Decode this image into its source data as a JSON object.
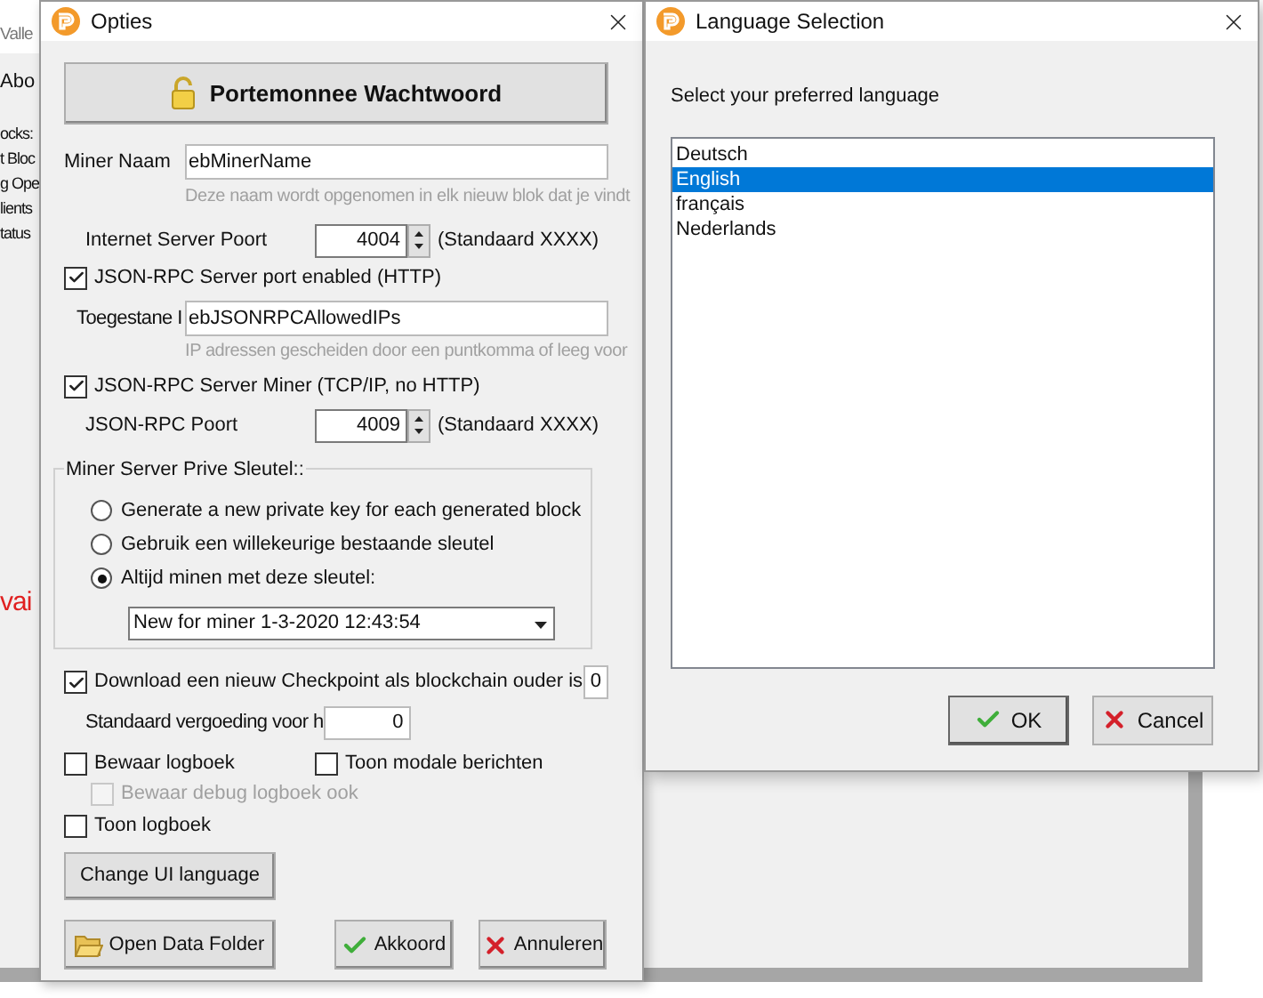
{
  "background_window": {
    "title": "Valle",
    "menu": "Abo",
    "lines": [
      "ocks:",
      "t Bloc",
      "g Ope",
      "lients",
      "tatus"
    ],
    "alert": "vai"
  },
  "options_dialog": {
    "title": "Opties",
    "password_button": "Portemonnee Wachtwoord",
    "miner_name": {
      "label": "Miner Naam",
      "value": "ebMinerName",
      "hint": "Deze naam wordt opgenomen in elk nieuw blok dat je vindt"
    },
    "server_port": {
      "label": "Internet Server Poort",
      "value": "4004",
      "note": "(Standaard XXXX)"
    },
    "rpc_enabled": {
      "label": "JSON-RPC Server port enabled (HTTP)",
      "checked": true
    },
    "allowed_ips": {
      "label": "Toegestane I",
      "value": "ebJSONRPCAllowedIPs",
      "hint": "IP adressen gescheiden door een puntkomma of leeg voor"
    },
    "rpc_miner": {
      "label": "JSON-RPC Server Miner (TCP/IP, no HTTP)",
      "checked": true
    },
    "rpc_port": {
      "label": "JSON-RPC Poort",
      "value": "4009",
      "note": "(Standaard XXXX)"
    },
    "key_group": {
      "title": "Miner Server Prive Sleutel::",
      "options": [
        {
          "label": "Generate a new private key for each generated block",
          "selected": false
        },
        {
          "label": "Gebruik een willekeurige bestaande sleutel",
          "selected": false
        },
        {
          "label": "Altijd minen met deze sleutel:",
          "selected": true
        }
      ],
      "key_select": "New for miner 1-3-2020 12:43:54"
    },
    "checkpoint": {
      "label": "Download een nieuw Checkpoint als blockchain ouder is",
      "checked": true,
      "value": "0"
    },
    "default_fee": {
      "label": "Standaard vergoeding voor h",
      "value": "0"
    },
    "save_log": {
      "label": "Bewaar logboek",
      "checked": false
    },
    "modal_messages": {
      "label": "Toon modale berichten",
      "checked": false
    },
    "save_debug_log": {
      "label": "Bewaar debug logboek ook",
      "checked": false,
      "disabled": true
    },
    "show_log": {
      "label": "Toon logboek",
      "checked": false
    },
    "change_language_button": "Change UI language",
    "buttons": [
      {
        "kind": "folder",
        "label": "Open Data Folder"
      },
      {
        "kind": "ok",
        "label": "Akkoord"
      },
      {
        "kind": "cancel",
        "label": "Annuleren"
      }
    ]
  },
  "language_dialog": {
    "title": "Language Selection",
    "prompt": "Select your preferred language",
    "languages": [
      {
        "label": "Deutsch",
        "selected": false
      },
      {
        "label": "English",
        "selected": true
      },
      {
        "label": "français",
        "selected": false
      },
      {
        "label": "Nederlands",
        "selected": false
      }
    ],
    "buttons": [
      {
        "kind": "ok",
        "label": "OK"
      },
      {
        "kind": "cancel",
        "label": "Cancel"
      }
    ]
  }
}
